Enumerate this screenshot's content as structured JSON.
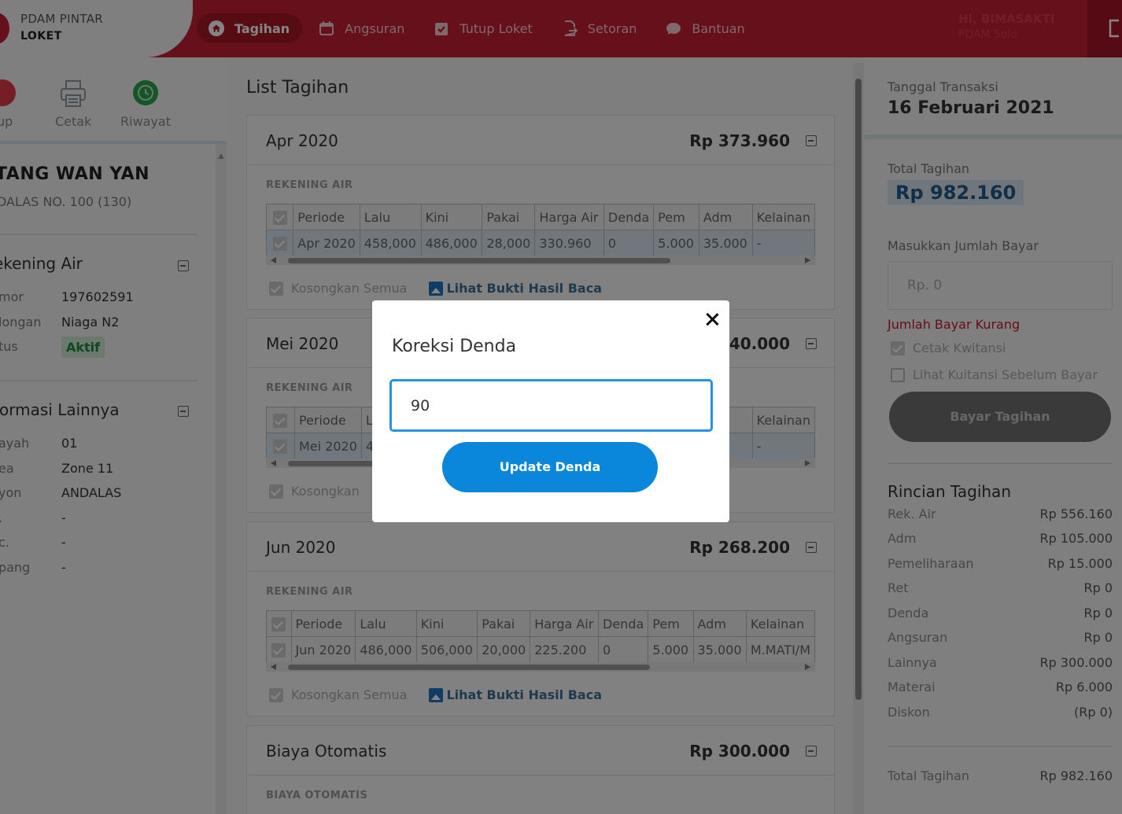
{
  "brand": {
    "title": "PDAM PINTAR",
    "subtitle": "LOKET"
  },
  "nav": [
    {
      "label": "Tagihan",
      "icon": "home-icon",
      "active": true
    },
    {
      "label": "Angsuran",
      "icon": "calendar-icon"
    },
    {
      "label": "Tutup Loket",
      "icon": "clipboard-check-icon"
    },
    {
      "label": "Setoran",
      "icon": "document-export-icon"
    },
    {
      "label": "Bantuan",
      "icon": "chat-bubble-icon"
    }
  ],
  "user": {
    "greeting": "HI, BIMASAKTI",
    "org": "PDAM Solo"
  },
  "toolbar": {
    "close_label": "tup",
    "print_label": "Cetak",
    "history_label": "Riwayat"
  },
  "customer": {
    "name": "TANG WAN YAN",
    "address": "DALAS NO. 100 (130)"
  },
  "rekening_section": {
    "title": "ekening Air",
    "rows": [
      {
        "key": "mor",
        "value": "197602591"
      },
      {
        "key": "longan",
        "value": "Niaga N2"
      },
      {
        "key": "tus",
        "value": "Aktif"
      }
    ]
  },
  "info_section": {
    "title": "formasi Lainnya",
    "rows": [
      {
        "key": "ayah",
        "value": "01"
      },
      {
        "key": "ea",
        "value": "Zone 11"
      },
      {
        "key": "yon",
        "value": "ANDALAS"
      },
      {
        "key": ".",
        "value": "-"
      },
      {
        "key": "c.",
        "value": "-"
      },
      {
        "key": "pang",
        "value": "-"
      }
    ]
  },
  "list_title": "List Tagihan",
  "table_headers": [
    "Periode",
    "Lalu",
    "Kini",
    "Pakai",
    "Harga Air",
    "Denda",
    "Pem",
    "Adm",
    "Kelainan"
  ],
  "cards": [
    {
      "period": "Apr 2020",
      "amount": "Rp 373.960",
      "sub_label": "REKENING AIR",
      "row": [
        "Apr 2020",
        "458,000",
        "486,000",
        "28,000",
        "330.960",
        "0",
        "5.000",
        "35.000",
        "-"
      ],
      "clear_label": "Kosongkan Semua",
      "link_label": "Lihat Bukti Hasil Baca"
    },
    {
      "period": "Mei 2020",
      "amount": "40.000",
      "sub_label": "REKENING AIR",
      "row": [
        "Mei 2020",
        "4",
        "",
        "",
        "",
        "",
        "",
        "00",
        "-"
      ],
      "clear_label": "Kosongkan"
    },
    {
      "period": "Jun 2020",
      "amount": "Rp 268.200",
      "sub_label": "REKENING AIR",
      "row": [
        "Jun 2020",
        "486,000",
        "506,000",
        "20,000",
        "225.200",
        "0",
        "5.000",
        "35.000",
        "M.MATI/M"
      ],
      "clear_label": "Kosongkan Semua",
      "link_label": "Lihat Bukti Hasil Baca"
    },
    {
      "period": "Biaya Otomatis",
      "amount": "Rp 300.000",
      "sub_label": "BIAYA OTOMATIS"
    }
  ],
  "summary": {
    "date_label": "Tanggal Transaksi",
    "date": "16 Februari 2021",
    "total_label": "Total Tagihan",
    "total": "Rp 982.160",
    "pay_label": "Masukkan Jumlah Bayar",
    "pay_placeholder": "Rp. 0",
    "warning": "Jumlah Bayar Kurang",
    "print_receipt": "Cetak Kwitansi",
    "preview_receipt": "Lihat Kuitansi Sebelum Bayar",
    "pay_button": "Bayar Tagihan",
    "detail_title": "Rincian Tagihan",
    "details": [
      {
        "key": "Rek. Air",
        "value": "Rp 556.160"
      },
      {
        "key": "Adm",
        "value": "Rp 105.000"
      },
      {
        "key": "Pemeliharaan",
        "value": "Rp 15.000"
      },
      {
        "key": "Ret",
        "value": "Rp 0"
      },
      {
        "key": "Denda",
        "value": "Rp 0"
      },
      {
        "key": "Angsuran",
        "value": "Rp 0"
      },
      {
        "key": "Lainnya",
        "value": "Rp 300.000"
      },
      {
        "key": "Materai",
        "value": "Rp 6.000"
      },
      {
        "key": "Diskon",
        "value": "(Rp 0)"
      }
    ],
    "grand_total_label": "Total Tagihan",
    "grand_total": "Rp 982.160"
  },
  "modal": {
    "title": "Koreksi Denda",
    "input_value": "90",
    "button": "Update Denda"
  },
  "colors": {
    "primary": "#c21f33",
    "accent_blue": "#0a87db",
    "status_green": "#1e8b3a",
    "warning_red": "#c81a2a"
  }
}
